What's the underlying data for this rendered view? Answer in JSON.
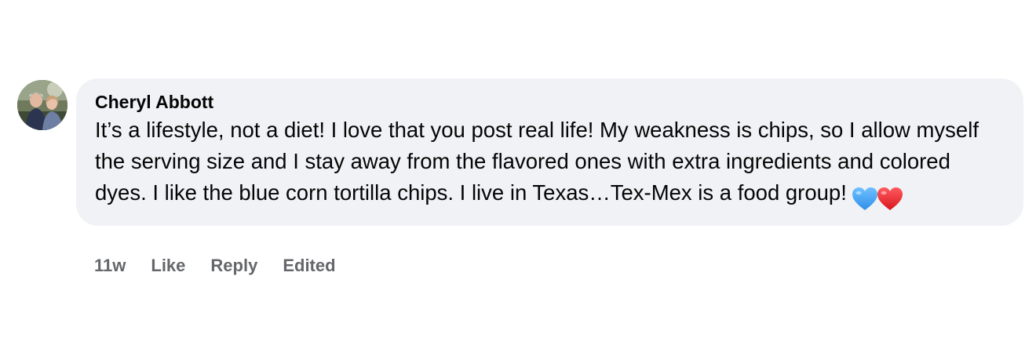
{
  "comment": {
    "author": "Cheryl Abbott",
    "text": "It’s a lifestyle, not a diet! I love that you post real life! My weakness is chips, so I allow myself the serving size and I stay away from the flavored ones with extra ingredients and colored dyes. I like the blue corn tortilla chips. I live in Texas…Tex-Mex is a food group!",
    "emojis": [
      "blue-heart-icon",
      "red-heart-icon"
    ],
    "colors": {
      "bubble": "#f0f2f5",
      "text": "#050505",
      "meta": "#65676b",
      "blue_heart": "#3d9cf0",
      "red_heart": "#e8232b"
    }
  },
  "actions": {
    "time": "11w",
    "like_label": "Like",
    "reply_label": "Reply",
    "edited_label": "Edited"
  }
}
